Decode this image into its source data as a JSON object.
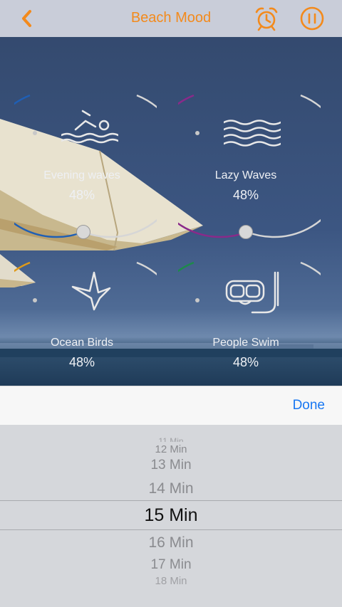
{
  "header": {
    "title": "Beach Mood"
  },
  "sounds": [
    {
      "name": "Evening waves",
      "percent": "48%",
      "color": "#1f5fb5"
    },
    {
      "name": "Lazy Waves",
      "percent": "48%",
      "color": "#8a2a8a"
    },
    {
      "name": "Ocean Birds",
      "percent": "48%",
      "color": "#e09a1a"
    },
    {
      "name": "People Swim",
      "percent": "48%",
      "color": "#1d8a4a"
    }
  ],
  "picker": {
    "done_label": "Done",
    "options": [
      "11 Min",
      "12 Min",
      "13 Min",
      "14 Min",
      "15 Min",
      "16 Min",
      "17 Min",
      "18 Min"
    ],
    "selected": "15 Min"
  },
  "colors": {
    "accent": "#f38a1c",
    "done": "#1877f2"
  }
}
